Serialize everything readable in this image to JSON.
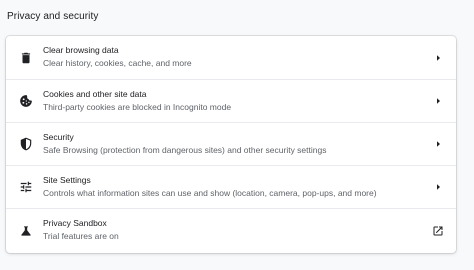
{
  "section": {
    "title": "Privacy and security"
  },
  "colors": {
    "background": "#f8f9fa",
    "card": "#ffffff",
    "primary_text": "#202124",
    "secondary_text": "#5f6368",
    "icon": "#202124",
    "divider": "#e8eaed"
  },
  "rows": [
    {
      "label": "Clear browsing data",
      "sub": "Clear history, cookies, cache, and more",
      "icon": "trash-icon",
      "trailing_icon": "chevron-right-icon"
    },
    {
      "label": "Cookies and other site data",
      "sub": "Third-party cookies are blocked in Incognito mode",
      "icon": "cookie-icon",
      "trailing_icon": "chevron-right-icon"
    },
    {
      "label": "Security",
      "sub": "Safe Browsing (protection from dangerous sites) and other security settings",
      "icon": "shield-icon",
      "trailing_icon": "chevron-right-icon"
    },
    {
      "label": "Site Settings",
      "sub": "Controls what information sites can use and show (location, camera, pop-ups, and more)",
      "icon": "tune-icon",
      "trailing_icon": "chevron-right-icon"
    },
    {
      "label": "Privacy Sandbox",
      "sub": "Trial features are on",
      "icon": "flask-icon",
      "trailing_icon": "open-in-new-icon"
    }
  ]
}
